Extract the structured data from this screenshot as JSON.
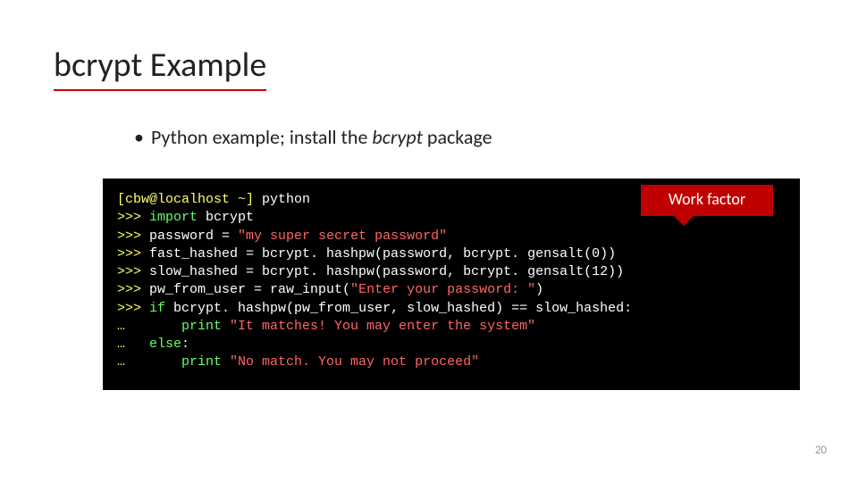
{
  "title": "bcrypt Example",
  "bullet": {
    "prefix": "Python example; install the ",
    "italic": "bcrypt",
    "suffix": " package"
  },
  "callout": "Work factor",
  "page_number": "20",
  "code": {
    "l1_prompt": "[cbw@localhost ~] ",
    "l1_cmd": "python",
    "l2_p": ">>> ",
    "l2_k": "import ",
    "l2_r": "bcrypt",
    "l3_p": ">>> ",
    "l3_a": "password = ",
    "l3_s": "\"my super secret password\"",
    "l4_p": ">>> ",
    "l4_r": "fast_hashed = bcrypt. hashpw(password, bcrypt. gensalt(0))",
    "l5_p": ">>> ",
    "l5_r": "slow_hashed = bcrypt. hashpw(password, bcrypt. gensalt(12))",
    "l6_p": ">>> ",
    "l6_a": "pw_from_user = raw_input(",
    "l6_s": "\"Enter your password: \"",
    "l6_b": ")",
    "l7_p": ">>> ",
    "l7_k": "if ",
    "l7_r": "bcrypt. hashpw(pw_from_user, slow_hashed) == slow_hashed:",
    "l8_p": "…       ",
    "l8_k": "print ",
    "l8_s": "\"It matches! You may enter the system\"",
    "l9_p": "…   ",
    "l9_k": "else",
    "l9_r": ":",
    "l10_p": "…       ",
    "l10_k": "print ",
    "l10_s": "\"No match. You may not proceed\""
  }
}
